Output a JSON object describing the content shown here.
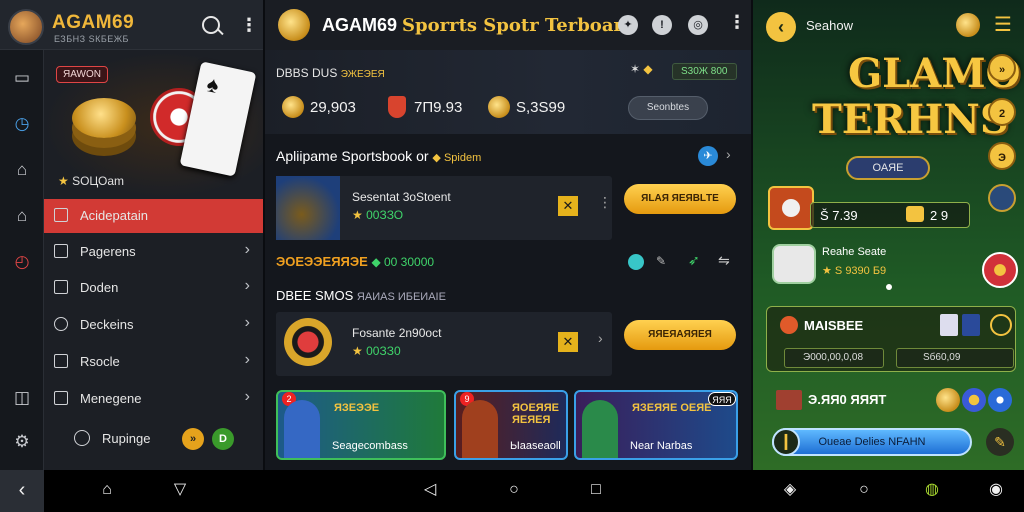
{
  "left": {
    "brand_title": "AGAM69",
    "brand_sub": "ЕЗБНЗ SКБЕЖБ",
    "promo_badge": "ЯAWON",
    "promo_caption": "SOЦОam",
    "menu": [
      {
        "label": "Acidepatain",
        "active": true
      },
      {
        "label": "Pagerens",
        "active": false
      },
      {
        "label": "Doden",
        "active": false
      },
      {
        "label": "Deckeins",
        "active": false
      },
      {
        "label": "Rsocle",
        "active": false
      },
      {
        "label": "Menegene",
        "active": false
      }
    ],
    "help_label": "Rupinge",
    "help_badges": [
      "»",
      "D"
    ]
  },
  "middle": {
    "title_white": "AGAM69",
    "title_gold": "Sporrts Spotr Terboart",
    "balance_label": "DBBS DUS",
    "balance_label_accent": "ЭЖЕЭЕЯ",
    "balances": [
      "29,903",
      "7П9.93",
      "S,3S99"
    ],
    "top_pill": "S30Ж 800",
    "view_button": "Seonbtes",
    "section1": "Apliipame Sportsbook",
    "section1_or": "or",
    "section1_sub": "Spidem",
    "match1": {
      "title": "Sesentat 3oStoent",
      "odds": "00ЗЗО",
      "bet_label": "ЯLAЯ ЯЕЯВLТЕ"
    },
    "row2_label": "ЭОЕЭЭЕЯЯЭЕ",
    "row2_value": "00 30000",
    "section2": "DBEE SMOS",
    "section2_sub": "ЯAИAS ИБЕИАІЕ",
    "match2": {
      "title": "Fosante 2n90oct",
      "odds": "00ЗЗ0",
      "bet_label": "ЯЯЕЯАЯЯЕЯ"
    },
    "promos": [
      {
        "headline": "ЯЗЕЭЭЕ",
        "label": "Seagecombass",
        "tag": "2"
      },
      {
        "headline": "ЯОЕЯЯЕ ЯЕЯЕЯ",
        "label": "Ыааseaoll",
        "tag": "9"
      },
      {
        "headline": "ЯЗЕЯЯЕ ОЕЯЕ",
        "label": "Near Narbas",
        "tag": "2"
      }
    ],
    "promo_badge_right": "ЯЯЯ"
  },
  "right": {
    "search_label": "Seahow",
    "headline_1": "GLAMO",
    "headline_2": "TERHNS",
    "game_button": "ОАЯЕ",
    "side_buttons": [
      "»",
      "2",
      "Э"
    ],
    "balance_left": "Š 7.39",
    "balance_right": "2 9",
    "bonus_title": "Reahe Seate",
    "bonus_value": "S 9390 Б9",
    "box_title": "MAISBEE",
    "box_a": "Э000,00,0,08",
    "box_b": "Sб60,09",
    "hash_label": "Э.ЯЯ0 ЯЯЯТ",
    "cta_label": "Oueae Delies  NFAHN"
  },
  "colors": {
    "gold": "#f3c340",
    "active_red": "#d23a35",
    "green": "#3fd46a",
    "bet_orange": "#ffd150"
  },
  "icons": {
    "nav": [
      "back-icon",
      "home-icon",
      "recent-icon",
      "triangle-back-icon",
      "circle-home-icon",
      "square-recent-icon",
      "shield-icon",
      "circle-icon",
      "controller-icon",
      "profile-icon"
    ]
  }
}
